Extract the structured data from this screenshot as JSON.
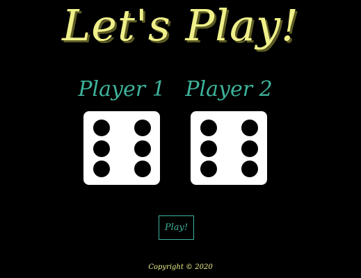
{
  "title": "Let's Play!",
  "players": [
    {
      "name": "Player 1",
      "die_value": 6
    },
    {
      "name": "Player 2",
      "die_value": 6
    }
  ],
  "play_button_label": "Play!",
  "footer": "Copyright © 2020",
  "colors": {
    "background": "#000000",
    "title": "#eff08a",
    "player_name": "#3db39b",
    "die_face": "#ffffff",
    "pip": "#000000",
    "button_border": "#3db39b",
    "footer": "#eff08a"
  }
}
